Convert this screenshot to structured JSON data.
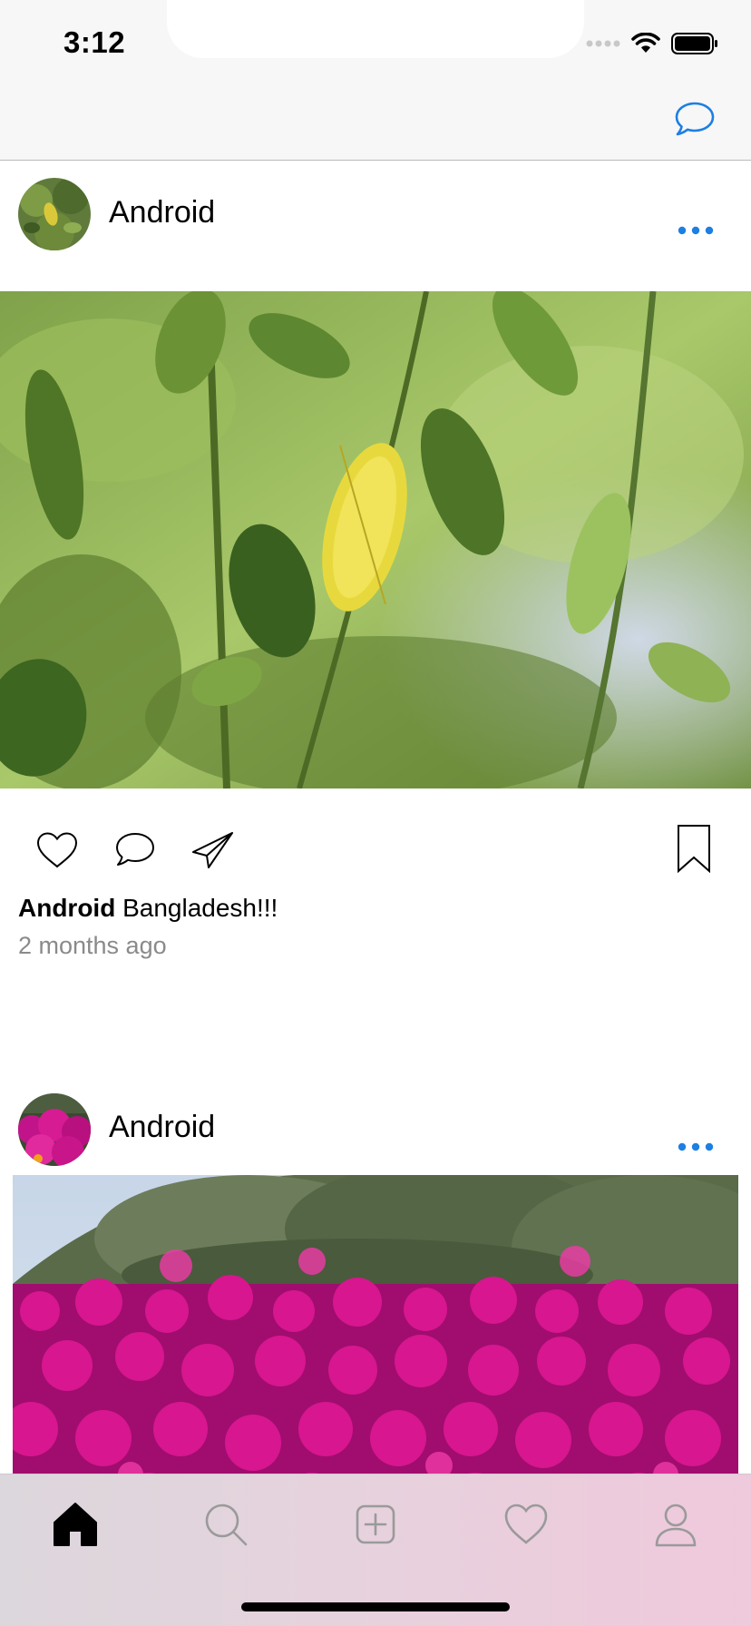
{
  "status_bar": {
    "time": "3:12"
  },
  "nav_bar": {
    "messages_icon": "chat-bubble-icon",
    "accent_color": "#1d7fe3"
  },
  "posts": [
    {
      "username": "Android",
      "caption_user": "Android",
      "caption_text": "Bangladesh!!!",
      "timestamp": "2 months ago",
      "image_subject": "green-leaves"
    },
    {
      "username": "Android",
      "image_subject": "pink-flowers"
    }
  ],
  "tab_bar": {
    "items": [
      {
        "icon": "home-icon",
        "selected": true
      },
      {
        "icon": "search-icon",
        "selected": false
      },
      {
        "icon": "add-post-icon",
        "selected": false
      },
      {
        "icon": "activity-heart-icon",
        "selected": false
      },
      {
        "icon": "profile-icon",
        "selected": false
      }
    ]
  }
}
